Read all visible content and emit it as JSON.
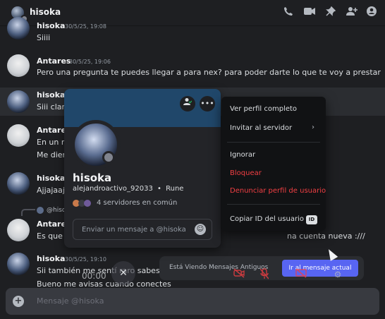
{
  "header": {
    "name": "hisoka",
    "icons": [
      "phone-icon",
      "video-icon",
      "pin-icon",
      "add-friend-icon",
      "profile-icon"
    ]
  },
  "messages": [
    {
      "name": "hisoka",
      "time": "30/5/25, 19:08",
      "lines": [
        "Siiii"
      ]
    },
    {
      "name": "Antares",
      "time": "30/5/25, 19:06",
      "lines": [
        "Pero una pregunta te puedes llegar a para nex? para poder darte lo que te voy a prestar"
      ]
    },
    {
      "name": "hisoka",
      "time": "",
      "lines": [
        "Siii clar"
      ]
    },
    {
      "name": "Antares",
      "time": "",
      "lines": [
        "En un m",
        "Me dier"
      ]
    },
    {
      "name": "hisoka",
      "time": "",
      "lines": [
        "Ajjajaaj"
      ]
    },
    {
      "name": "Antares",
      "time": "",
      "reply_to": "@hiso",
      "lines": [
        "Es que s"
      ],
      "tail": "na cuenta nueva :///"
    },
    {
      "name": "hisoka",
      "time": "30/5/25, 19:10",
      "lines": [
        "Sii también me sentí raro sabes jje",
        "Bueno me avisas cuando conectes"
      ]
    }
  ],
  "profile": {
    "display_name": "hisoka",
    "username": "alejandroactivo_92033",
    "separator": "•",
    "rune": "Rune",
    "mutual_servers": "4 servidores en común",
    "message_placeholder": "Enviar un mensaje a @hisoka",
    "btn_icons": [
      "friend-check-icon",
      "more-icon"
    ]
  },
  "context_menu": {
    "items": [
      {
        "label": "Ver perfil completo",
        "danger": false
      },
      {
        "label": "Invitar al servidor",
        "danger": false,
        "submenu": true
      },
      {
        "label": "Ignorar",
        "danger": false
      },
      {
        "label": "Bloquear",
        "danger": true
      },
      {
        "label": "Denunciar perfil de usuario",
        "danger": true
      },
      {
        "label": "Copiar ID del usuario",
        "danger": false,
        "badge": "ID"
      }
    ]
  },
  "old_messages": {
    "text": "Está Viendo Mensajes Antiguos",
    "button": "Ir al mensaje actual"
  },
  "call": {
    "timer": "00:00"
  },
  "composer": {
    "placeholder": "Mensaje @hisoka"
  },
  "colors": {
    "accent": "#5865f2",
    "danger": "#f23f43",
    "banner": "#20476a"
  }
}
